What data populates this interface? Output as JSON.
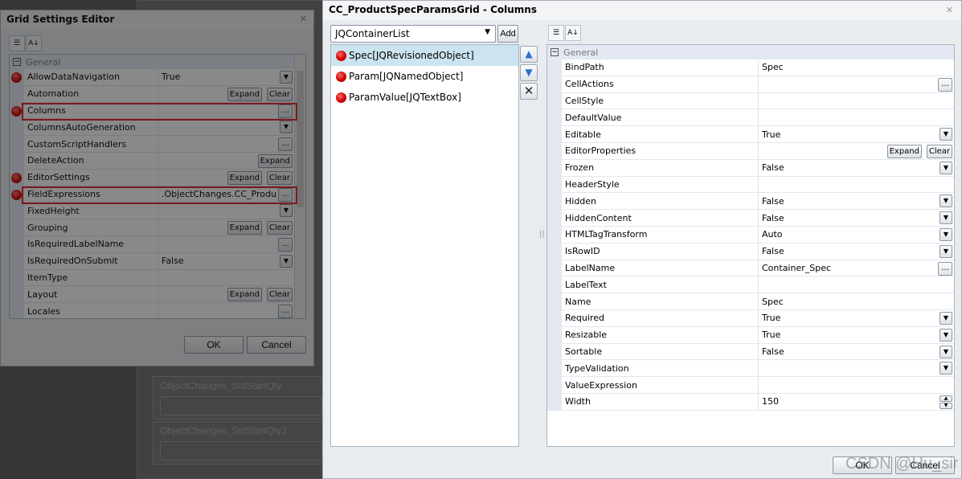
{
  "background": {
    "fields": [
      "ObjectChanges_StdStartQty",
      "ObjectChanges_StdStartQty2"
    ]
  },
  "grid_settings": {
    "title": "Grid Settings Editor",
    "category": "General",
    "rows": [
      {
        "name": "AllowDataNavigation",
        "value": "True",
        "control": "dropdown",
        "dot": true
      },
      {
        "name": "Automation",
        "value": "",
        "control": "expand-clear",
        "dot": false
      },
      {
        "name": "Columns",
        "value": "",
        "control": "ellipsis",
        "dot": true,
        "highlight": true
      },
      {
        "name": "ColumnsAutoGeneration",
        "value": "",
        "control": "dropdown",
        "dot": false
      },
      {
        "name": "CustomScriptHandlers",
        "value": "",
        "control": "ellipsis",
        "dot": false
      },
      {
        "name": "DeleteAction",
        "value": "",
        "control": "expand",
        "dot": false
      },
      {
        "name": "EditorSettings",
        "value": "",
        "control": "expand-clear",
        "dot": true
      },
      {
        "name": "FieldExpressions",
        "value": ".ObjectChanges.CC_Produ",
        "control": "ellipsis",
        "dot": true,
        "highlight": true
      },
      {
        "name": "FixedHeight",
        "value": "",
        "control": "dropdown",
        "dot": false
      },
      {
        "name": "Grouping",
        "value": "",
        "control": "expand-clear",
        "dot": false
      },
      {
        "name": "IsRequiredLabelName",
        "value": "",
        "control": "ellipsis",
        "dot": false
      },
      {
        "name": "IsRequiredOnSubmit",
        "value": "False",
        "control": "dropdown",
        "dot": false
      },
      {
        "name": "ItemType",
        "value": "",
        "control": "none",
        "dot": false
      },
      {
        "name": "Layout",
        "value": "",
        "control": "expand-clear",
        "dot": false
      },
      {
        "name": "Locales",
        "value": "",
        "control": "ellipsis",
        "dot": false
      }
    ],
    "expand_label": "Expand",
    "clear_label": "Clear",
    "ellipsis_label": "...",
    "ok_label": "OK",
    "cancel_label": "Cancel"
  },
  "columns_dialog": {
    "title": "CC_ProductSpecParamsGrid - Columns",
    "type_select": "JQContainerList",
    "add_label": "Add",
    "items": [
      "Spec[JQRevisionedObject]",
      "Param[JQNamedObject]",
      "ParamValue[JQTextBox]"
    ],
    "selected_index": 0,
    "category": "General",
    "rows": [
      {
        "name": "BindPath",
        "value": "Spec",
        "control": "none"
      },
      {
        "name": "CellActions",
        "value": "",
        "control": "ellipsis"
      },
      {
        "name": "CellStyle",
        "value": "",
        "control": "none"
      },
      {
        "name": "DefaultValue",
        "value": "",
        "control": "none"
      },
      {
        "name": "Editable",
        "value": "True",
        "control": "dropdown"
      },
      {
        "name": "EditorProperties",
        "value": "",
        "control": "expand-clear"
      },
      {
        "name": "Frozen",
        "value": "False",
        "control": "dropdown"
      },
      {
        "name": "HeaderStyle",
        "value": "",
        "control": "none"
      },
      {
        "name": "Hidden",
        "value": "False",
        "control": "dropdown"
      },
      {
        "name": "HiddenContent",
        "value": "False",
        "control": "dropdown"
      },
      {
        "name": "HTMLTagTransform",
        "value": "Auto",
        "control": "dropdown"
      },
      {
        "name": "IsRowID",
        "value": "False",
        "control": "dropdown"
      },
      {
        "name": "LabelName",
        "value": "Container_Spec",
        "control": "ellipsis"
      },
      {
        "name": "LabelText",
        "value": "",
        "control": "none"
      },
      {
        "name": "Name",
        "value": "Spec",
        "control": "none"
      },
      {
        "name": "Required",
        "value": "True",
        "control": "dropdown"
      },
      {
        "name": "Resizable",
        "value": "True",
        "control": "dropdown"
      },
      {
        "name": "Sortable",
        "value": "False",
        "control": "dropdown"
      },
      {
        "name": "TypeValidation",
        "value": "",
        "control": "dropdown"
      },
      {
        "name": "ValueExpression",
        "value": "",
        "control": "none"
      },
      {
        "name": "Width",
        "value": "150",
        "control": "spinner"
      }
    ],
    "splitter": "||",
    "ok_label": "OK",
    "cancel_label": "Cancel",
    "watermark": "CSDN @Hu_sir"
  }
}
